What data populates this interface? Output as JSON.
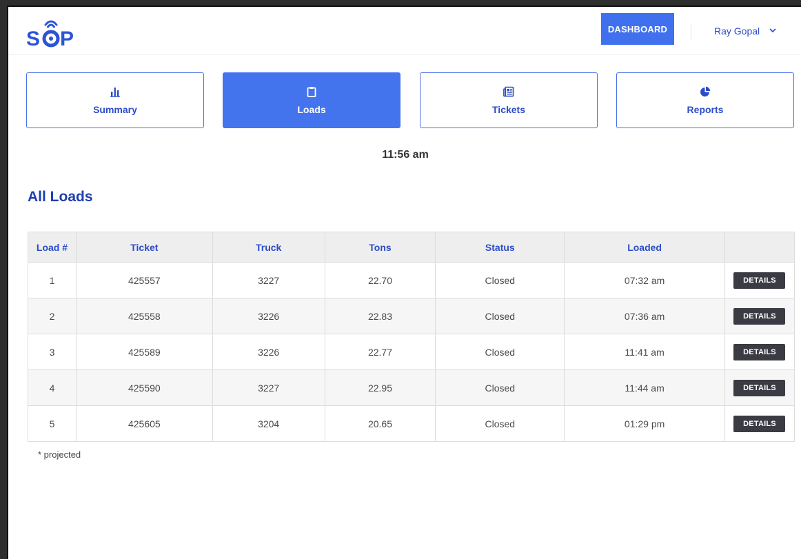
{
  "header": {
    "logo_text": "SOP",
    "dashboard_label": "DASHBOARD",
    "user_name": "Ray Gopal",
    "user_chevron": "⌄"
  },
  "tabs": [
    {
      "label": "Summary",
      "icon": "bar-chart-icon",
      "active": false
    },
    {
      "label": "Loads",
      "icon": "clipboard-icon",
      "active": true
    },
    {
      "label": "Tickets",
      "icon": "newspaper-icon",
      "active": false
    },
    {
      "label": "Reports",
      "icon": "pie-chart-icon",
      "active": false
    }
  ],
  "time": "11:56 am",
  "section_title": "All Loads",
  "table": {
    "headers": [
      "Load #",
      "Ticket",
      "Truck",
      "Tons",
      "Status",
      "Loaded",
      ""
    ],
    "details_label": "DETAILS",
    "rows": [
      {
        "load": "1",
        "ticket": "425557",
        "truck": "3227",
        "tons": "22.70",
        "status": "Closed",
        "loaded": "07:32 am"
      },
      {
        "load": "2",
        "ticket": "425558",
        "truck": "3226",
        "tons": "22.83",
        "status": "Closed",
        "loaded": "07:36 am"
      },
      {
        "load": "3",
        "ticket": "425589",
        "truck": "3226",
        "tons": "22.77",
        "status": "Closed",
        "loaded": "11:41 am"
      },
      {
        "load": "4",
        "ticket": "425590",
        "truck": "3227",
        "tons": "22.95",
        "status": "Closed",
        "loaded": "11:44 am"
      },
      {
        "load": "5",
        "ticket": "425605",
        "truck": "3204",
        "tons": "20.65",
        "status": "Closed",
        "loaded": "01:29 pm"
      }
    ]
  },
  "footnote": "* projected",
  "colors": {
    "accent": "#4473ee",
    "brand_text": "#1d3fae",
    "details_button": "#3b3b44"
  }
}
